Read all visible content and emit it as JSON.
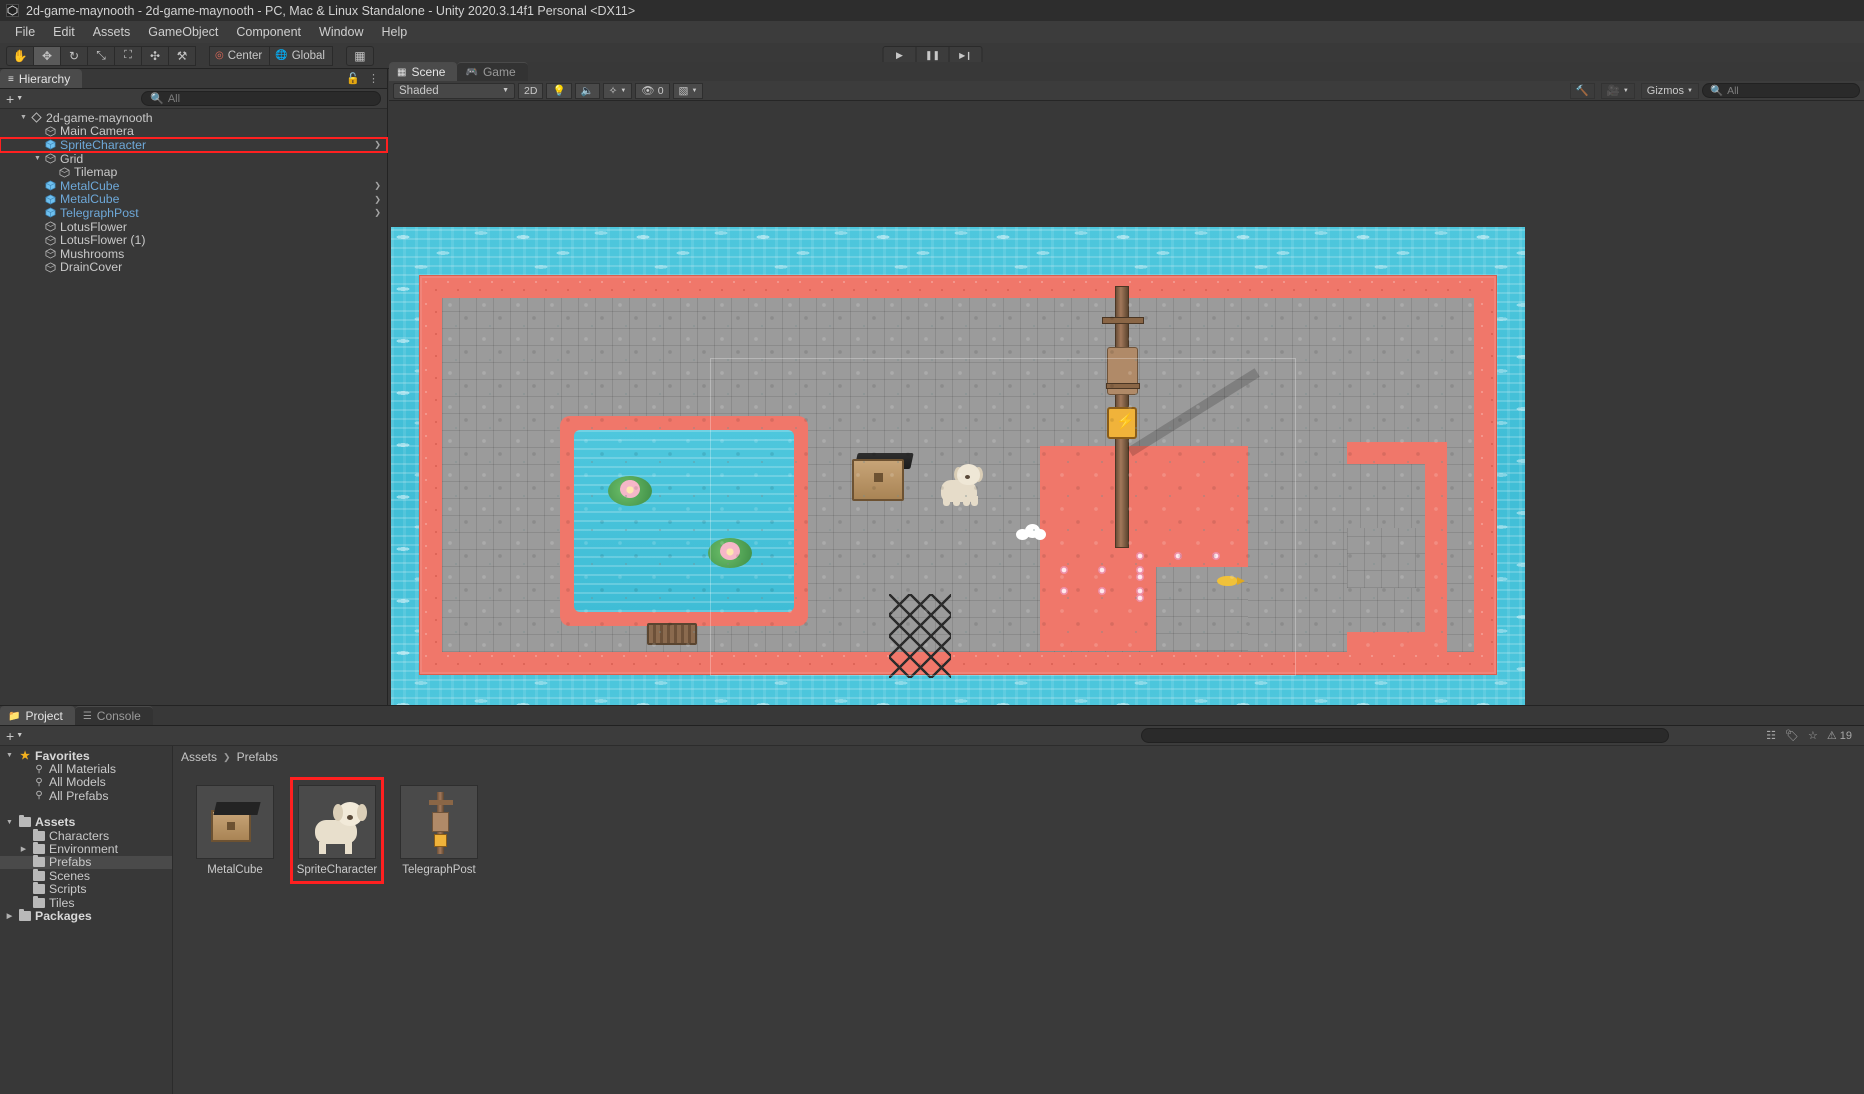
{
  "window": {
    "title": "2d-game-maynooth - 2d-game-maynooth - PC, Mac & Linux Standalone - Unity 2020.3.14f1 Personal <DX11>",
    "app_icon": "unity-icon"
  },
  "menubar": {
    "items": [
      "File",
      "Edit",
      "Assets",
      "GameObject",
      "Component",
      "Window",
      "Help"
    ]
  },
  "toolbar": {
    "tools": [
      {
        "name": "hand-tool",
        "glyph": "✋",
        "active": false
      },
      {
        "name": "move-tool",
        "glyph": "✥",
        "active": true
      },
      {
        "name": "rotate-tool",
        "glyph": "↻",
        "active": false
      },
      {
        "name": "scale-tool",
        "glyph": "⤡",
        "active": false
      },
      {
        "name": "rect-tool",
        "glyph": "⛶",
        "active": false
      },
      {
        "name": "transform-tool",
        "glyph": "✣",
        "active": false
      },
      {
        "name": "custom-editor-tool",
        "glyph": "⚒",
        "active": false
      }
    ],
    "pivot_label": "Center",
    "handle_label": "Global",
    "grid_toggle": "grid-icon",
    "play_label": "▶",
    "pause_label": "❚❚",
    "step_label": "▶❙"
  },
  "hierarchy": {
    "tab_label": "Hierarchy",
    "tab_icon": "hierarchy-icon",
    "add_label": "+",
    "search_placeholder": "All",
    "search_value": "",
    "lock_icon": "lock-icon",
    "menu_icon": "kebab-menu-icon",
    "items": [
      {
        "label": "2d-game-maynooth",
        "depth": 0,
        "icon": "unity-scene-icon",
        "expanded": true,
        "prefab": false,
        "selected": false,
        "chevron": false
      },
      {
        "label": "Main Camera",
        "depth": 1,
        "icon": "gameobject-icon",
        "expanded": null,
        "prefab": false,
        "selected": false,
        "chevron": false
      },
      {
        "label": "SpriteCharacter",
        "depth": 1,
        "icon": "prefab-icon",
        "expanded": null,
        "prefab": true,
        "selected": true,
        "chevron": true
      },
      {
        "label": "Grid",
        "depth": 1,
        "icon": "gameobject-icon",
        "expanded": true,
        "prefab": false,
        "selected": false,
        "chevron": false
      },
      {
        "label": "Tilemap",
        "depth": 2,
        "icon": "gameobject-icon",
        "expanded": null,
        "prefab": false,
        "selected": false,
        "chevron": false
      },
      {
        "label": "MetalCube",
        "depth": 1,
        "icon": "prefab-icon",
        "expanded": null,
        "prefab": true,
        "selected": false,
        "chevron": true
      },
      {
        "label": "MetalCube",
        "depth": 1,
        "icon": "prefab-icon",
        "expanded": null,
        "prefab": true,
        "selected": false,
        "chevron": true
      },
      {
        "label": "TelegraphPost",
        "depth": 1,
        "icon": "prefab-icon",
        "expanded": null,
        "prefab": true,
        "selected": false,
        "chevron": true
      },
      {
        "label": "LotusFlower",
        "depth": 1,
        "icon": "gameobject-icon",
        "expanded": null,
        "prefab": false,
        "selected": false,
        "chevron": false
      },
      {
        "label": "LotusFlower (1)",
        "depth": 1,
        "icon": "gameobject-icon",
        "expanded": null,
        "prefab": false,
        "selected": false,
        "chevron": false
      },
      {
        "label": "Mushrooms",
        "depth": 1,
        "icon": "gameobject-icon",
        "expanded": null,
        "prefab": false,
        "selected": false,
        "chevron": false
      },
      {
        "label": "DrainCover",
        "depth": 1,
        "icon": "gameobject-icon",
        "expanded": null,
        "prefab": false,
        "selected": false,
        "chevron": false
      }
    ]
  },
  "scene_view": {
    "tabs": [
      {
        "label": "Scene",
        "icon": "scene-icon",
        "selected": true
      },
      {
        "label": "Game",
        "icon": "game-icon",
        "selected": false
      }
    ],
    "draw_mode": "Shaded",
    "mode_2d": "2D",
    "lighting_icon": "lightbulb-icon",
    "audio_icon": "speaker-icon",
    "fx_icon": "effects-icon",
    "hidden_count": "0",
    "hidden_icon": "hidden-objects-icon",
    "grid_icon": "grid-visibility-icon",
    "tool_icon": "scene-tools-icon",
    "camera_icon": "scene-camera-icon",
    "gizmos_label": "Gizmos",
    "search_placeholder": "All",
    "search_value": ""
  },
  "project": {
    "tabs": [
      {
        "label": "Project",
        "icon": "folder-icon",
        "selected": true
      },
      {
        "label": "Console",
        "icon": "console-icon",
        "selected": false
      }
    ],
    "add_label": "+",
    "search_value": "",
    "right_icons": [
      "filter-by-type-icon",
      "filter-by-label-icon",
      "favorite-star-icon"
    ],
    "warning_count": "19",
    "tree": [
      {
        "label": "Favorites",
        "depth": 0,
        "icon": "star-icon",
        "expanded": true,
        "bold": true,
        "selected": false
      },
      {
        "label": "All Materials",
        "depth": 1,
        "icon": "search-icon",
        "expanded": null,
        "bold": false,
        "selected": false
      },
      {
        "label": "All Models",
        "depth": 1,
        "icon": "search-icon",
        "expanded": null,
        "bold": false,
        "selected": false
      },
      {
        "label": "All Prefabs",
        "depth": 1,
        "icon": "search-icon",
        "expanded": null,
        "bold": false,
        "selected": false
      },
      {
        "label": "",
        "depth": 0,
        "icon": "spacer",
        "expanded": null,
        "bold": false,
        "selected": false
      },
      {
        "label": "Assets",
        "depth": 0,
        "icon": "folder-icon",
        "expanded": true,
        "bold": true,
        "selected": false
      },
      {
        "label": "Characters",
        "depth": 1,
        "icon": "folder-icon",
        "expanded": null,
        "bold": false,
        "selected": false
      },
      {
        "label": "Environment",
        "depth": 1,
        "icon": "folder-icon",
        "expanded": false,
        "bold": false,
        "selected": false
      },
      {
        "label": "Prefabs",
        "depth": 1,
        "icon": "folder-icon",
        "expanded": null,
        "bold": false,
        "selected": true
      },
      {
        "label": "Scenes",
        "depth": 1,
        "icon": "folder-icon",
        "expanded": null,
        "bold": false,
        "selected": false
      },
      {
        "label": "Scripts",
        "depth": 1,
        "icon": "folder-icon",
        "expanded": null,
        "bold": false,
        "selected": false
      },
      {
        "label": "Tiles",
        "depth": 1,
        "icon": "folder-icon",
        "expanded": null,
        "bold": false,
        "selected": false
      },
      {
        "label": "Packages",
        "depth": 0,
        "icon": "folder-icon",
        "expanded": false,
        "bold": true,
        "selected": false
      }
    ],
    "breadcrumb": [
      "Assets",
      "Prefabs"
    ],
    "assets": [
      {
        "label": "MetalCube",
        "thumb": "metal-cube-thumb",
        "selected": false
      },
      {
        "label": "SpriteCharacter",
        "thumb": "sprite-character-thumb",
        "selected": true
      },
      {
        "label": "TelegraphPost",
        "thumb": "telegraph-post-thumb",
        "selected": false
      }
    ]
  },
  "colors": {
    "accent_selection": "#ff2020",
    "prefab_blue": "#6ea8d8",
    "panel_bg": "#383838",
    "coral": "#f0776a",
    "water": "#4ec7dd",
    "floor": "#9b9b9b"
  }
}
